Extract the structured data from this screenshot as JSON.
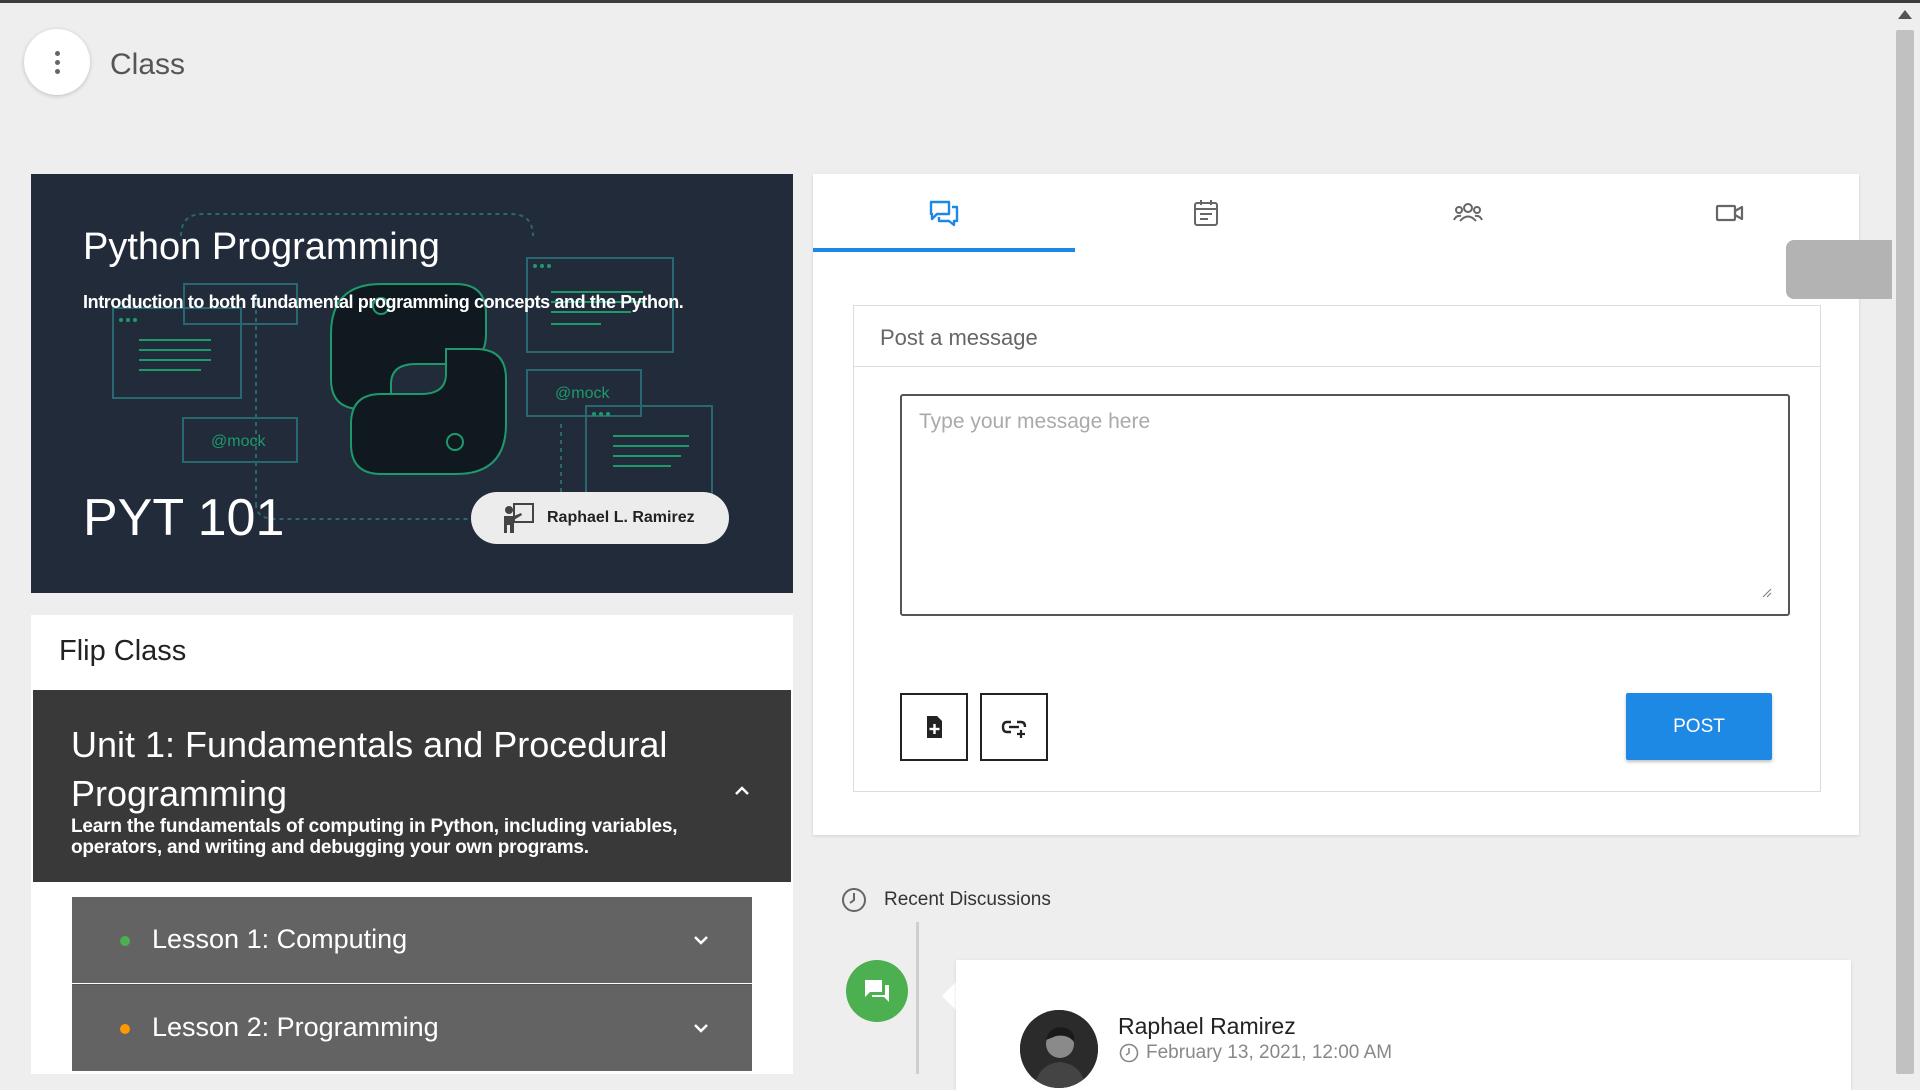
{
  "header": {
    "title": "Class"
  },
  "course": {
    "title": "Python Programming",
    "subtitle": "Introduction to both fundamental programming concepts and the Python.",
    "code": "PYT 101",
    "instructor": "Raphael L. Ramirez",
    "banner_art_text": [
      "@mock",
      "@mock"
    ]
  },
  "flip_class": {
    "title": "Flip Class",
    "unit": {
      "title": "Unit 1: Fundamentals and Procedural Programming",
      "description": "Learn the fundamentals of computing in Python, including variables, operators, and writing and debugging your own programs."
    },
    "lessons": [
      {
        "label": "Lesson 1: Computing",
        "status_color": "#4caf50"
      },
      {
        "label": "Lesson 2: Programming",
        "status_color": "#ff9800"
      }
    ]
  },
  "tabs": [
    {
      "icon": "forum-icon",
      "active": true
    },
    {
      "icon": "calendar-icon",
      "active": false
    },
    {
      "icon": "people-icon",
      "active": false
    },
    {
      "icon": "video-icon",
      "active": false
    }
  ],
  "post": {
    "heading": "Post a message",
    "placeholder": "Type your message here",
    "attach_file_icon": "add-file-icon",
    "attach_link_icon": "add-link-icon",
    "button_label": "POST"
  },
  "recent": {
    "heading": "Recent Discussions",
    "items": [
      {
        "author": "Raphael Ramirez",
        "date": "February 13, 2021, 12:00 AM"
      }
    ]
  },
  "colors": {
    "accent": "#1e88e5",
    "banner_bg": "#222b3a",
    "unit_bg": "#393939",
    "lesson_bg": "#636363",
    "success": "#4caf50"
  }
}
